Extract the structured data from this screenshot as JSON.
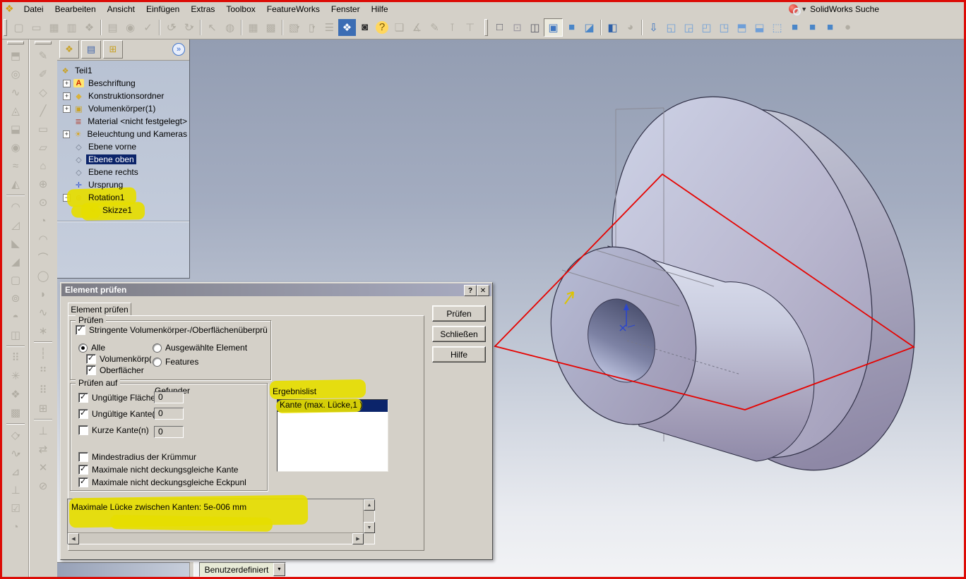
{
  "colors": {
    "selection": "#0b246a",
    "highlighter": "#e6dd00",
    "plane_red": "#e60300",
    "chrome": "#d4d0c8",
    "brand_red": "#c01010"
  },
  "menu_bar": {
    "items": [
      "Datei",
      "Bearbeiten",
      "Ansicht",
      "Einfügen",
      "Extras",
      "Toolbox",
      "FeatureWorks",
      "Fenster",
      "Hilfe"
    ],
    "search_label": "SolidWorks Suche",
    "search_arrow": "▼"
  },
  "toolbar_main": {
    "items": [
      {
        "name": "new-file-button",
        "glyph": "▢"
      },
      {
        "name": "open-file-button",
        "glyph": "▭"
      },
      {
        "name": "save-button",
        "glyph": "▦"
      },
      {
        "name": "window-layout-button",
        "glyph": "▥"
      },
      {
        "name": "publish-edrawing-button",
        "glyph": "❖"
      },
      {
        "name": "separator",
        "sep": true
      },
      {
        "name": "print-button",
        "glyph": "▤"
      },
      {
        "name": "print-preview-button",
        "glyph": "◉"
      },
      {
        "name": "spell-check-button",
        "glyph": "✓"
      },
      {
        "name": "separator",
        "sep": true
      },
      {
        "name": "undo-button",
        "glyph": "↺",
        "dd": true
      },
      {
        "name": "redo-button",
        "glyph": "↻",
        "dd": true
      },
      {
        "name": "separator",
        "sep": true
      },
      {
        "name": "select-button",
        "glyph": "↖"
      },
      {
        "name": "selection-filter-button",
        "glyph": "◍"
      },
      {
        "name": "separator",
        "sep": true
      },
      {
        "name": "sketch-grid-button",
        "glyph": "▦"
      },
      {
        "name": "texture-button",
        "glyph": "▩"
      },
      {
        "name": "separator",
        "sep": true
      },
      {
        "name": "shaded-display-button",
        "glyph": "▧",
        "dd": true
      },
      {
        "name": "drawing-sheet-button",
        "glyph": "▯",
        "dd": true
      },
      {
        "name": "design-tree-button",
        "glyph": "☰"
      },
      {
        "name": "zoom-to-fit-button",
        "glyph": "❖",
        "fg": "#ffffff",
        "bg": "#3b6db4"
      },
      {
        "name": "screen-capture-button",
        "glyph": "◙",
        "fg": "#2b2b2b"
      },
      {
        "name": "help-button",
        "glyph": "?",
        "fg": "#7a5800",
        "bg": "#ffd75e",
        "round": true
      },
      {
        "name": "appearance-button",
        "glyph": "❏"
      },
      {
        "name": "measure-button",
        "glyph": "∡"
      },
      {
        "name": "sketch-entities-button",
        "glyph": "✎"
      },
      {
        "name": "pin-button",
        "glyph": "⊺"
      },
      {
        "name": "lamp-button",
        "glyph": "⊤"
      }
    ]
  },
  "toolbar_view": {
    "items": [
      {
        "name": "wireframe-button",
        "glyph": "□",
        "fg": "#5a5a66"
      },
      {
        "name": "hidden-lines-visible-button",
        "glyph": "⊡",
        "fg": "#9a96a0"
      },
      {
        "name": "hidden-lines-removed-button",
        "glyph": "◫",
        "fg": "#5a5a66"
      },
      {
        "name": "shaded-with-edges-button",
        "glyph": "▣",
        "fg": "#3f76c0",
        "pressed": true
      },
      {
        "name": "shaded-button",
        "glyph": "■",
        "fg": "#4a86c8"
      },
      {
        "name": "shadows-button",
        "glyph": "◪",
        "fg": "#4a86c8"
      },
      {
        "name": "separator",
        "sep": true
      },
      {
        "name": "section-view-button",
        "glyph": "◧",
        "fg": "#2d5fa8"
      },
      {
        "name": "curvature-button",
        "glyph": "◕",
        "fg": "#b1ada3"
      },
      {
        "name": "separator",
        "sep": true
      },
      {
        "name": "normal-to-button",
        "glyph": "⇩",
        "fg": "#3f76c0"
      },
      {
        "name": "view-front-button",
        "glyph": "◱",
        "fg": "#6f9fd8"
      },
      {
        "name": "view-back-button",
        "glyph": "◲",
        "fg": "#6f9fd8"
      },
      {
        "name": "view-left-button",
        "glyph": "◰",
        "fg": "#6f9fd8"
      },
      {
        "name": "view-right-button",
        "glyph": "◳",
        "fg": "#6f9fd8"
      },
      {
        "name": "view-top-button",
        "glyph": "⬒",
        "fg": "#6f9fd8"
      },
      {
        "name": "view-bottom-button",
        "glyph": "⬓",
        "fg": "#6f9fd8"
      },
      {
        "name": "view-isometric-button",
        "glyph": "⬚",
        "fg": "#6f9fd8"
      },
      {
        "name": "view-trimetric-button",
        "glyph": "■",
        "fg": "#4a86c8"
      },
      {
        "name": "view-dimetric-button",
        "glyph": "■",
        "fg": "#4a86c8"
      },
      {
        "name": "view-single-button",
        "glyph": "■",
        "fg": "#4a86c8"
      },
      {
        "name": "view-orientation-button",
        "glyph": "●",
        "fg": "#b1ada3"
      }
    ]
  },
  "toolbar_features": {
    "items": [
      {
        "name": "extruded-boss-button",
        "glyph": "⬒"
      },
      {
        "name": "revolved-boss-button",
        "glyph": "◎"
      },
      {
        "name": "swept-boss-button",
        "glyph": "∿"
      },
      {
        "name": "lofted-boss-button",
        "glyph": "◬"
      },
      {
        "name": "extruded-cut-button",
        "glyph": "⬓"
      },
      {
        "name": "revolved-cut-button",
        "glyph": "◉"
      },
      {
        "name": "swept-cut-button",
        "glyph": "≈"
      },
      {
        "name": "lofted-cut-button",
        "glyph": "◭"
      },
      {
        "name": "separator",
        "sep": true
      },
      {
        "name": "fillet-button",
        "glyph": "◠"
      },
      {
        "name": "chamfer-button",
        "glyph": "◿"
      },
      {
        "name": "rib-button",
        "glyph": "◣"
      },
      {
        "name": "draft-button",
        "glyph": "◢"
      },
      {
        "name": "shell-button",
        "glyph": "▢"
      },
      {
        "name": "hole-wizard-button",
        "glyph": "⊚"
      },
      {
        "name": "dome-button",
        "glyph": "◓"
      },
      {
        "name": "mirror-button",
        "glyph": "◫"
      },
      {
        "name": "separator",
        "sep": true
      },
      {
        "name": "linear-pattern-button",
        "glyph": "⠿"
      },
      {
        "name": "circular-pattern-button",
        "glyph": "✳"
      },
      {
        "name": "curve-pattern-button",
        "glyph": "❖"
      },
      {
        "name": "fill-pattern-button",
        "glyph": "▩"
      },
      {
        "name": "separator",
        "sep": true
      },
      {
        "name": "reference-geometry-button",
        "glyph": "◇",
        "dd": true
      },
      {
        "name": "curves-button",
        "glyph": "∿",
        "dd": true
      },
      {
        "name": "instant3d-button",
        "glyph": "⊿"
      },
      {
        "name": "design-study-button",
        "glyph": "⊥"
      },
      {
        "name": "sensors-button",
        "glyph": "☑"
      },
      {
        "name": "history-button",
        "glyph": "◔"
      }
    ]
  },
  "toolbar_sketch": {
    "items": [
      {
        "name": "sketch-button",
        "glyph": "✎"
      },
      {
        "name": "3d-sketch-button",
        "glyph": "✐"
      },
      {
        "name": "smart-dimension-button",
        "glyph": "◇"
      },
      {
        "name": "line-button",
        "glyph": "╱"
      },
      {
        "name": "rectangle-button",
        "glyph": "▭"
      },
      {
        "name": "parallelogram-button",
        "glyph": "▱"
      },
      {
        "name": "polygon-button",
        "glyph": "⌂"
      },
      {
        "name": "circle-button",
        "glyph": "⊕"
      },
      {
        "name": "perimeter-circle-button",
        "glyph": "⊙"
      },
      {
        "name": "centerpoint-arc-button",
        "glyph": "◔"
      },
      {
        "name": "tangent-arc-button",
        "glyph": "◠"
      },
      {
        "name": "three-point-arc-button",
        "glyph": "⌒"
      },
      {
        "name": "ellipse-button",
        "glyph": "◯"
      },
      {
        "name": "partial-ellipse-button",
        "glyph": "◗"
      },
      {
        "name": "spline-button",
        "glyph": "∿"
      },
      {
        "name": "point-button",
        "glyph": "∗"
      },
      {
        "name": "separator",
        "sep": true
      },
      {
        "name": "centerline-button",
        "glyph": "┆"
      },
      {
        "name": "convert-entities-button",
        "glyph": "⠛"
      },
      {
        "name": "offset-entities-button",
        "glyph": "⠿"
      },
      {
        "name": "mirror-entities-button",
        "glyph": "⊞"
      },
      {
        "name": "separator",
        "sep": true
      },
      {
        "name": "sketch-pattern-button",
        "glyph": "⊥"
      },
      {
        "name": "move-entities-button",
        "glyph": "⇄"
      },
      {
        "name": "trim-entities-button",
        "glyph": "✕"
      },
      {
        "name": "relations-button",
        "glyph": "⊘"
      }
    ]
  },
  "feature_tree": {
    "items": [
      {
        "label": "Teil1",
        "icon_glyph": "❖",
        "expand": ""
      },
      {
        "label": "Beschriftung",
        "icon_glyph": "A",
        "expand": "+"
      },
      {
        "label": "Konstruktionsordner",
        "icon_glyph": "◆",
        "expand": "+"
      },
      {
        "label": "Volumenkörper(1)",
        "icon_glyph": "▣",
        "expand": "+"
      },
      {
        "label": "Material <nicht festgelegt>",
        "icon_glyph": "≣",
        "expand": ""
      },
      {
        "label": "Beleuchtung und Kameras",
        "icon_glyph": "☀",
        "expand": "+"
      },
      {
        "label": "Ebene vorne",
        "icon_glyph": "◇",
        "expand": ""
      },
      {
        "label": "Ebene oben",
        "icon_glyph": "◇",
        "expand": ""
      },
      {
        "label": "Ebene rechts",
        "icon_glyph": "◇",
        "expand": ""
      },
      {
        "label": "Ursprung",
        "icon_glyph": "✛",
        "expand": ""
      },
      {
        "label": "Rotation1",
        "icon_glyph": "⊚",
        "expand": "−"
      },
      {
        "label": "Skizze1",
        "icon_glyph": "✎",
        "expand": ""
      }
    ]
  },
  "dialog": {
    "title": "Element prüfen",
    "help_btn": "?",
    "close_btn": "✕",
    "tab_label": "Element prüfen",
    "pruefen": {
      "legend": "Prüfen",
      "stringente": "Stringente Volumenkörper-/Oberflächenüberprü",
      "alle": "Alle",
      "ausgewaehlte": "Ausgewählte Element",
      "volumenkoerper": "Volumenkörp(",
      "features": "Features",
      "oberflaechen": "Oberflächer"
    },
    "pruefen_auf": {
      "legend": "Prüfen auf",
      "found_label": "Gefunder",
      "rows": [
        {
          "label": "Ungültige Fläche(n",
          "count": "0"
        },
        {
          "label": "Ungültige Kante(n",
          "count": "0"
        },
        {
          "label": "Kurze Kante(n)",
          "count": "0"
        }
      ],
      "extras": [
        {
          "label": "Mindestradius der Krümmur"
        },
        {
          "label": "Maximale nicht deckungsgleiche Kante"
        },
        {
          "label": "Maximale nicht deckungsgleiche Eckpunl"
        }
      ]
    },
    "ergebnis": {
      "label": "Ergebnislist",
      "selected_item": "Kante (max. Lücke,1  )"
    },
    "message": "Maximale Lücke zwischen Kanten: 5e-006 mm",
    "buttons": {
      "pruefen": "Prüfen",
      "schliessen": "Schließen",
      "hilfe": "Hilfe"
    }
  },
  "status_bar": {
    "units_combo": "Benutzerdefiniert"
  }
}
